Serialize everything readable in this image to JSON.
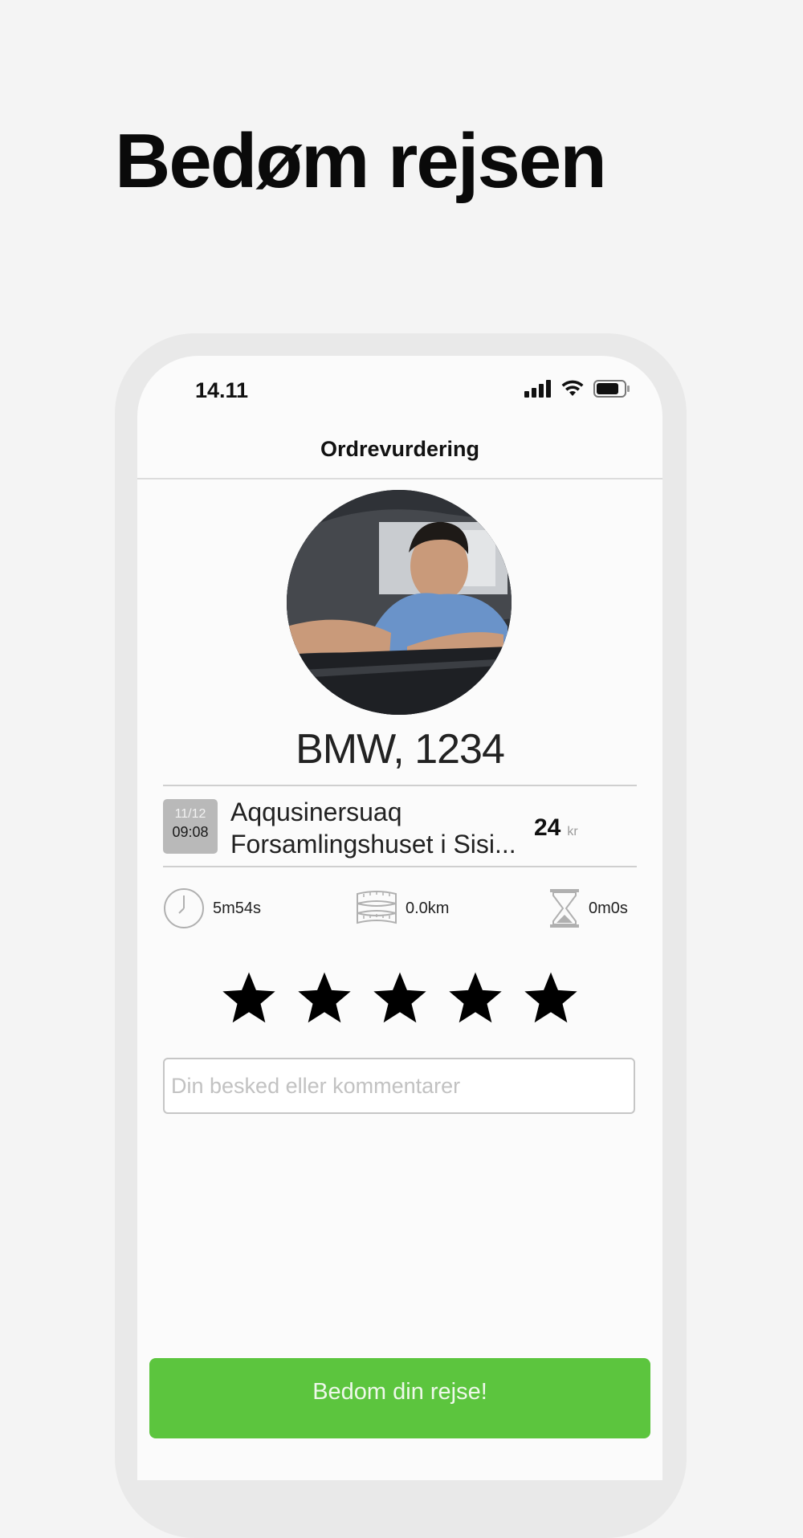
{
  "headline": "Bedøm rejsen",
  "status_bar": {
    "time": "14.11"
  },
  "nav": {
    "title": "Ordrevurdering"
  },
  "vehicle": "BMW, 1234",
  "trip": {
    "date": "11/12",
    "time": "09:08",
    "from": "Aqqusinersuaq",
    "to": "Forsamlingshuset i Sisi...",
    "price": "24",
    "currency": "kr"
  },
  "metrics": {
    "duration": "5m54s",
    "distance": "0.0km",
    "wait": "0m0s"
  },
  "rating": {
    "stars": 5,
    "max": 5
  },
  "comment": {
    "placeholder": "Din besked eller kommentarer"
  },
  "submit_label": "Bedom din rejse!",
  "colors": {
    "accent": "#5cc53e",
    "background": "#f4f4f4",
    "badge": "#b9b9b9"
  }
}
